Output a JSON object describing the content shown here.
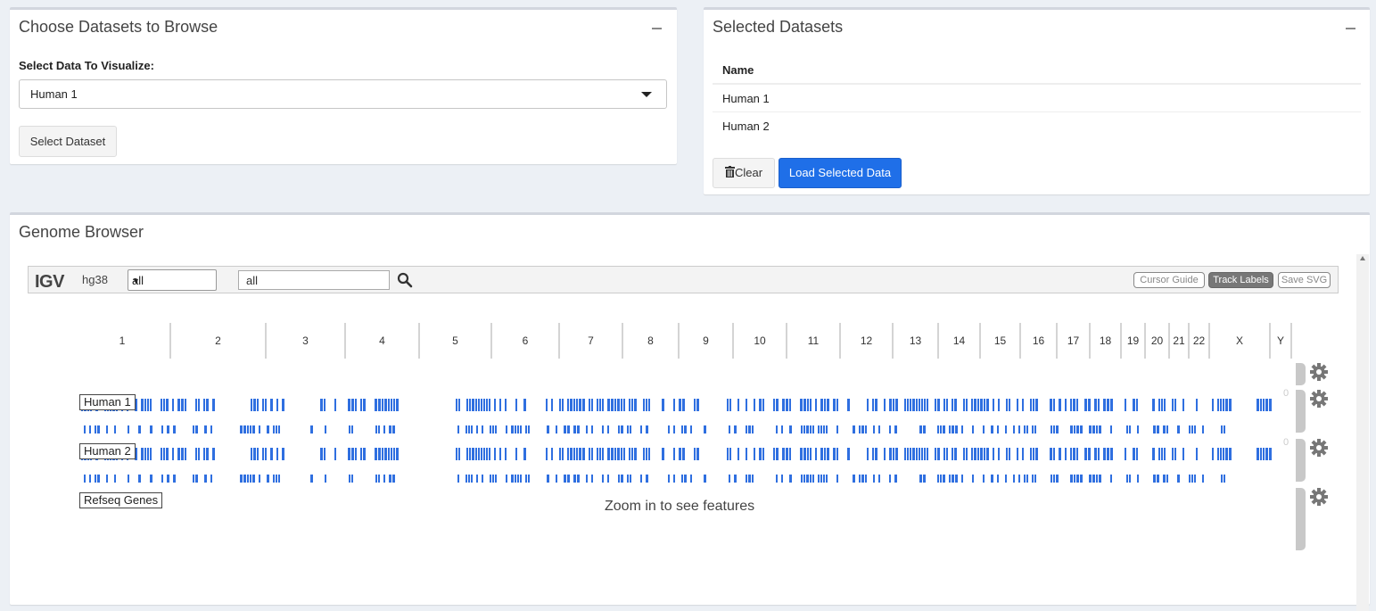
{
  "choose_panel": {
    "title": "Choose Datasets to Browse",
    "select_label": "Select Data To Visualize:",
    "select_value": "Human 1",
    "select_button": "Select Dataset"
  },
  "selected_panel": {
    "title": "Selected Datasets",
    "table_header": "Name",
    "rows": [
      "Human 1",
      "Human 2"
    ],
    "clear_button": "Clear",
    "load_button": "Load Selected Data"
  },
  "genome_panel": {
    "title": "Genome Browser",
    "igv": {
      "logo": "IGV",
      "genome": "hg38",
      "chromosome_select": "all",
      "locus_search": "all",
      "buttons": {
        "cursor_guide": "Cursor Guide",
        "track_labels": "Track Labels",
        "save_svg": "Save SVG"
      },
      "chromosomes": [
        "1",
        "2",
        "3",
        "4",
        "5",
        "6",
        "7",
        "8",
        "9",
        "10",
        "11",
        "12",
        "13",
        "14",
        "15",
        "16",
        "17",
        "18",
        "19",
        "20",
        "21",
        "22",
        "X",
        "Y"
      ],
      "tracks": [
        {
          "name": "Human 1",
          "scale_min": "0"
        },
        {
          "name": "Human 2",
          "scale_min": "0"
        },
        {
          "name": "Refseq Genes"
        }
      ],
      "zoom_message": "Zoom in to see features"
    }
  },
  "colors": {
    "primary": "#1f6fe8",
    "feature": "#2f6fe0",
    "background": "#ecf0f5"
  }
}
